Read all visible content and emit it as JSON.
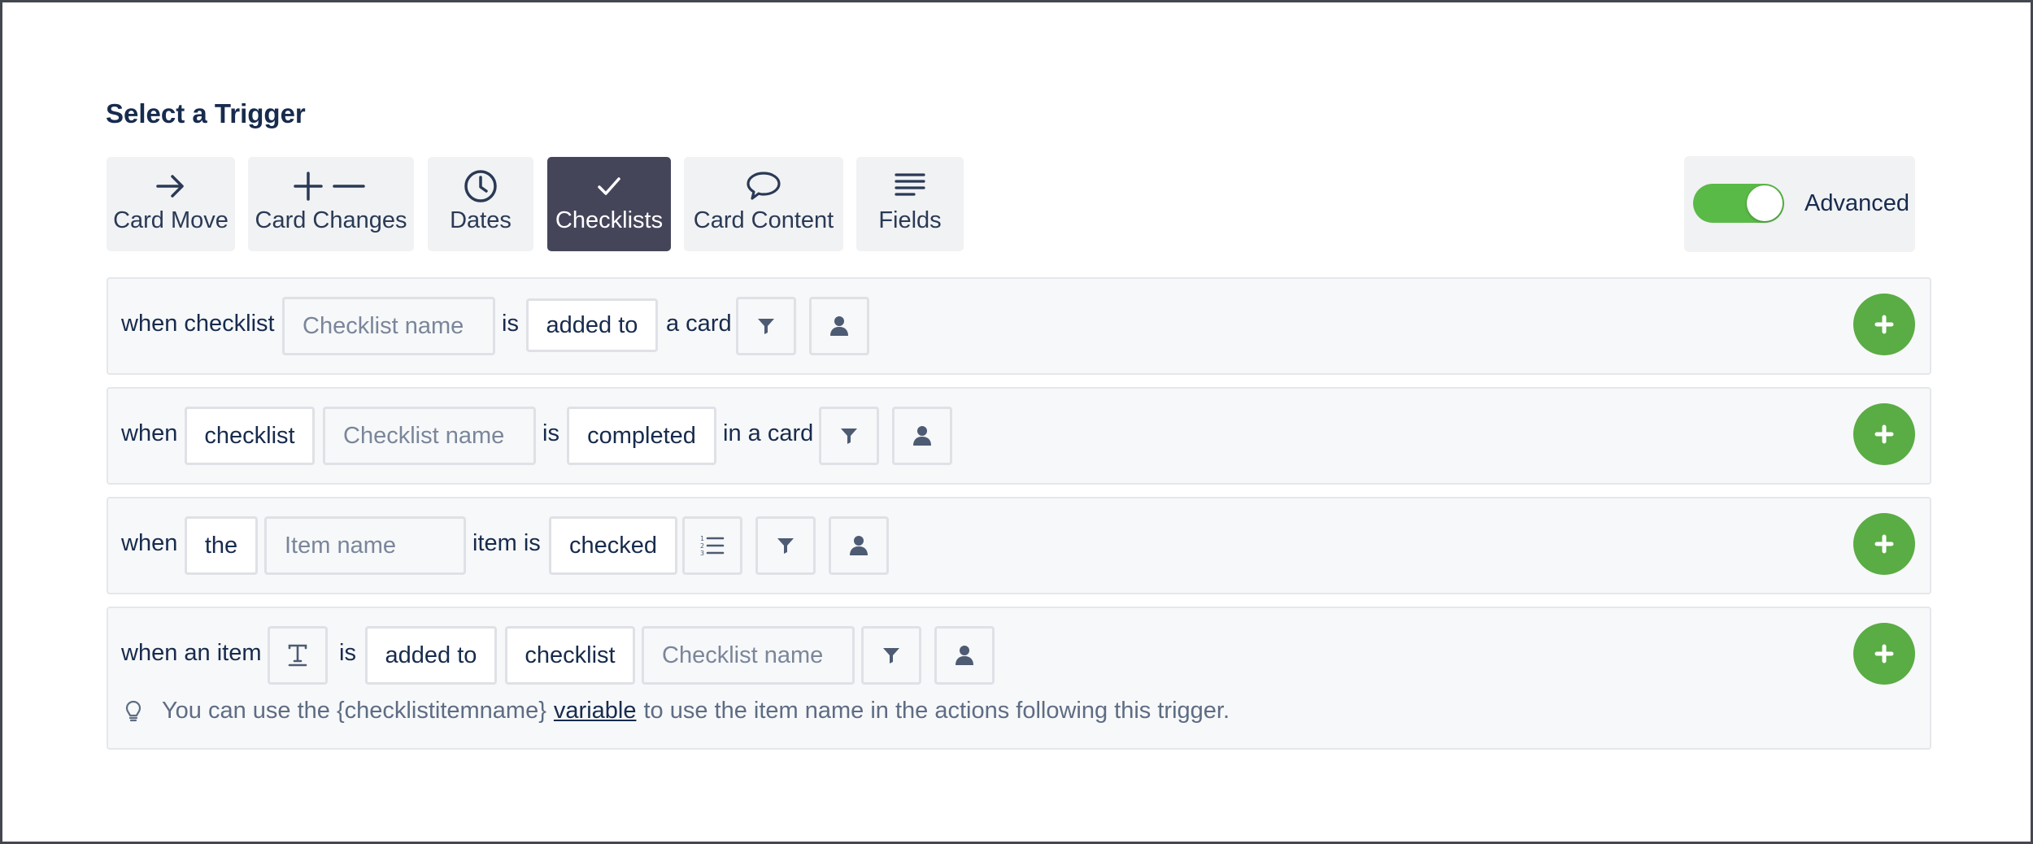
{
  "title": "Select a Trigger",
  "tabs": [
    {
      "label": "Card Move",
      "icon": "arrow-right-icon",
      "active": false
    },
    {
      "label": "Card Changes",
      "icon": "plus-minus-icon",
      "active": false
    },
    {
      "label": "Dates",
      "icon": "clock-icon",
      "active": false
    },
    {
      "label": "Checklists",
      "icon": "check-icon",
      "active": true
    },
    {
      "label": "Card Content",
      "icon": "speech-bubble-icon",
      "active": false
    },
    {
      "label": "Fields",
      "icon": "lines-icon",
      "active": false
    }
  ],
  "advanced": {
    "label": "Advanced",
    "enabled": true,
    "color": "#5aba47"
  },
  "rows": [
    {
      "t1": "when checklist",
      "name_placeholder": "Checklist name",
      "t2": "is",
      "action": "added to",
      "t3": "a card"
    },
    {
      "t1": "when",
      "type": "checklist",
      "name_placeholder": "Checklist name",
      "t2": "is",
      "action": "completed",
      "t3": "in a card"
    },
    {
      "t1": "when",
      "article": "the",
      "name_placeholder": "Item name",
      "t2": "item is",
      "action": "checked"
    },
    {
      "t1": "when an item",
      "t2": "is",
      "action": "added to",
      "type": "checklist",
      "name_placeholder": "Checklist name",
      "tip": {
        "before": "You can use the {checklistitemname}",
        "link": "variable",
        "after": "to use the item name in the actions following this trigger."
      }
    }
  ],
  "colors": {
    "accent_green": "#5aac44",
    "active_tab": "#45455a"
  }
}
